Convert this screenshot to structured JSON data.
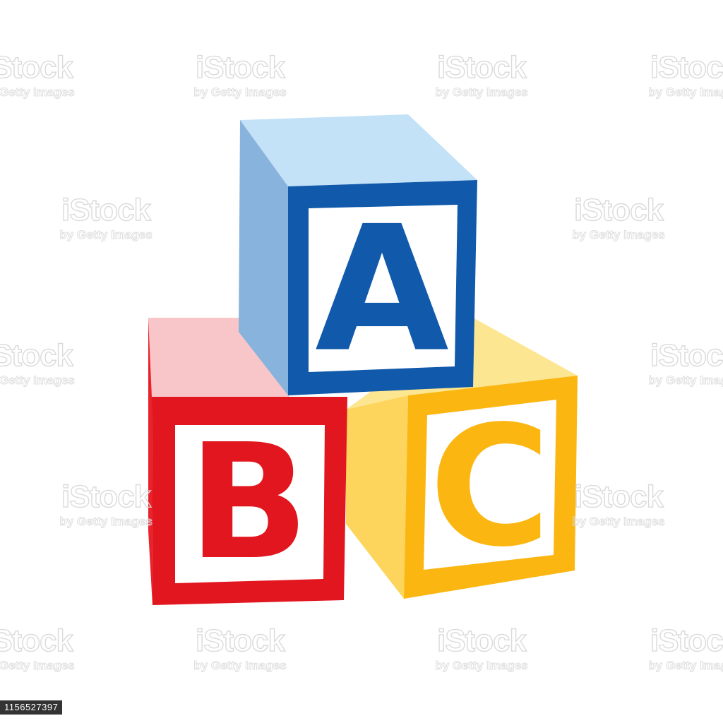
{
  "blocks": {
    "a": {
      "letter": "A",
      "colors": {
        "frame": "#1159ab",
        "side": "#88b3dc",
        "top": "#c3e2f7",
        "letter": "#1159ab"
      }
    },
    "b": {
      "letter": "B",
      "colors": {
        "frame": "#e1161f",
        "side": "#e9212b",
        "top": "#f8c6c9",
        "letter": "#e1161f"
      }
    },
    "c": {
      "letter": "C",
      "colors": {
        "frame": "#fbb611",
        "side": "#fdd55c",
        "top": "#fde691",
        "letter": "#fbb611"
      }
    }
  },
  "watermark": {
    "brand": "iStock",
    "tagline": "by Getty Images"
  },
  "stock_id": "1156527397"
}
